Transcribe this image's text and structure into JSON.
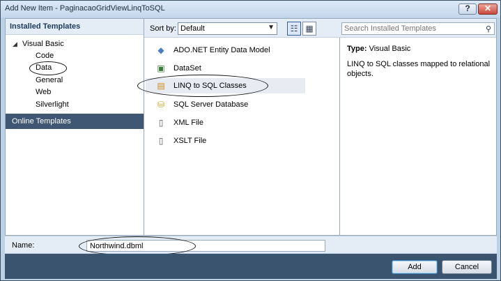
{
  "window": {
    "title": "Add New Item - PaginacaoGridViewLinqToSQL"
  },
  "title_buttons": {
    "help": "?",
    "close": "✕"
  },
  "sidebar": {
    "header": "Installed Templates",
    "root": {
      "label": "Visual Basic",
      "arrow": "◢"
    },
    "items": [
      {
        "label": "Code"
      },
      {
        "label": "Data"
      },
      {
        "label": "General"
      },
      {
        "label": "Web"
      },
      {
        "label": "Silverlight"
      }
    ],
    "online": "Online Templates"
  },
  "toolbar": {
    "sort_label": "Sort by:",
    "sort_value": "Default",
    "search_placeholder": "Search Installed Templates"
  },
  "templates": [
    {
      "name": "ADO.NET Entity Data Model",
      "icon": "entity-model-icon",
      "color": "#4a7ebf"
    },
    {
      "name": "DataSet",
      "icon": "dataset-icon",
      "color": "#3b7a3b"
    },
    {
      "name": "LINQ to SQL Classes",
      "icon": "linq-classes-icon",
      "color": "#c88b1e"
    },
    {
      "name": "SQL Server Database",
      "icon": "database-icon",
      "color": "#d4a017"
    },
    {
      "name": "XML File",
      "icon": "xml-file-icon",
      "color": "#555555"
    },
    {
      "name": "XSLT File",
      "icon": "xslt-file-icon",
      "color": "#555555"
    }
  ],
  "details": {
    "type_label": "Type:",
    "type_value": "Visual Basic",
    "description": "LINQ to SQL classes mapped to relational objects."
  },
  "name_field": {
    "label": "Name:",
    "value": "Northwind.dbml"
  },
  "buttons": {
    "add": "Add",
    "cancel": "Cancel"
  },
  "colors": {
    "selection_dark": "#3f5772",
    "panel_header": "#e4ecf6",
    "window_frame": "#bcd0e6"
  }
}
